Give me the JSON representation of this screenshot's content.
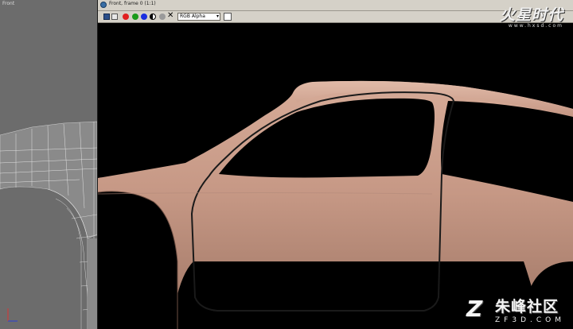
{
  "left_viewport": {
    "label": "Front"
  },
  "frame_window": {
    "title": "Front, frame 0 (1:1)",
    "toolbar": {
      "save_icon": "save-icon",
      "copy_icon": "copy-icon",
      "channels": [
        "red",
        "green",
        "blue",
        "mono",
        "alpha"
      ],
      "clear_symbol": "✕",
      "channel_select": "RGB Alpha",
      "channel_select_chevron": "▾"
    },
    "colors": {
      "body_paint": "#c99a86",
      "background": "#000000"
    }
  },
  "watermark_top": {
    "brand": "火星时代",
    "url": "www.hxsd.com"
  },
  "watermark_bottom": {
    "logo": "Z",
    "brand": "朱峰社区",
    "url": "ZF3D.COM"
  }
}
